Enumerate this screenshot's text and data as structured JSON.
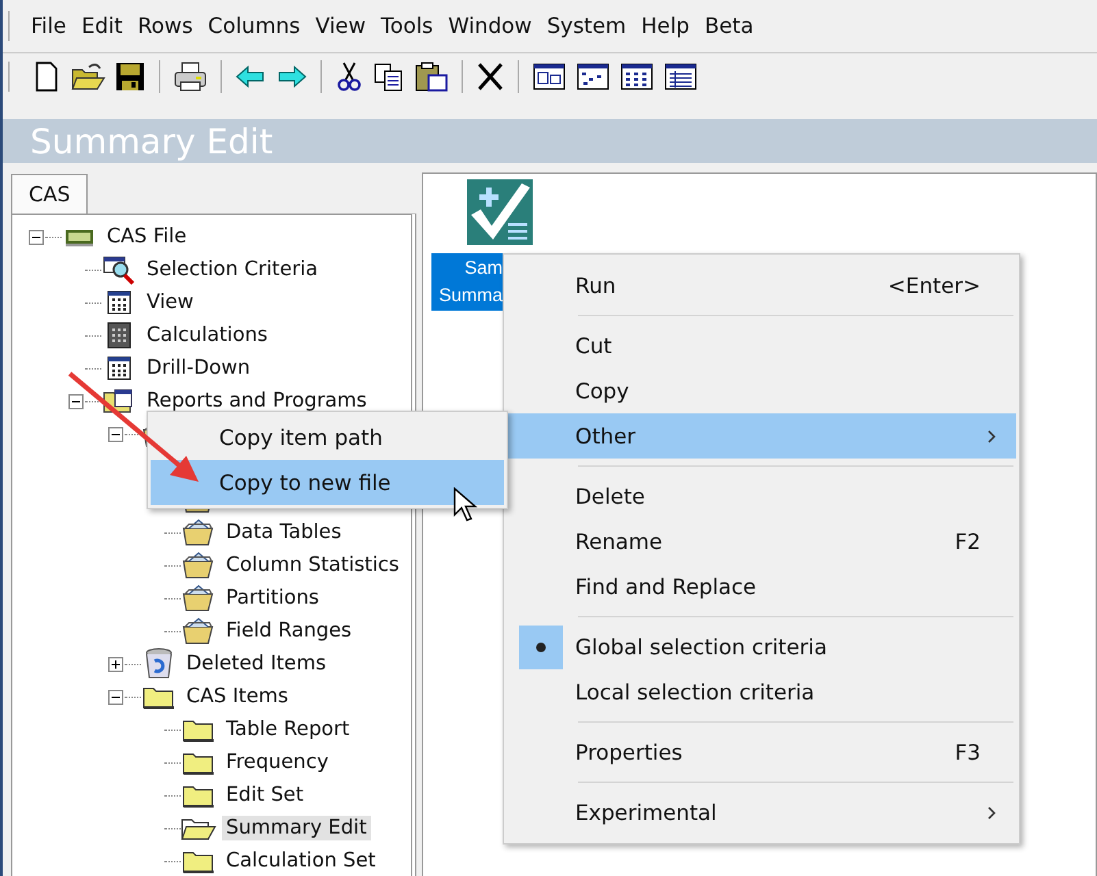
{
  "menu_bar": [
    "File",
    "Edit",
    "Rows",
    "Columns",
    "View",
    "Tools",
    "Window",
    "System",
    "Help",
    "Beta"
  ],
  "view_title": "Summary Edit",
  "tabs": [
    {
      "label": "CAS",
      "selected": true
    }
  ],
  "tree": [
    {
      "label": "CAS File",
      "kind": "file",
      "expanded": true,
      "selected": false,
      "children": [
        {
          "label": "Selection Criteria",
          "kind": "criteria",
          "selected": false
        },
        {
          "label": "View",
          "kind": "grid",
          "selected": false
        },
        {
          "label": "Calculations",
          "kind": "calc",
          "selected": false
        },
        {
          "label": "Drill-Down",
          "kind": "grid",
          "selected": false
        },
        {
          "label": "Reports and Programs",
          "kind": "reports",
          "expanded": true,
          "selected": false,
          "children": [
            {
              "kind": "report",
              "expanded": true,
              "children": [
                {
                  "kind": "hidden"
                },
                {
                  "kind": "report"
                },
                {
                  "label": "Data Tables",
                  "kind": "report",
                  "selected": false
                },
                {
                  "label": "Column Statistics",
                  "kind": "report",
                  "selected": false
                },
                {
                  "label": "Partitions",
                  "kind": "report",
                  "selected": false
                },
                {
                  "label": "Field Ranges",
                  "kind": "report",
                  "selected": false
                }
              ]
            },
            {
              "label": "Deleted Items",
              "kind": "trash",
              "expanded": false,
              "selected": false
            },
            {
              "label": "CAS Items",
              "kind": "folder",
              "expanded": true,
              "selected": false,
              "children": [
                {
                  "label": "Table Report",
                  "kind": "folder",
                  "selected": false
                },
                {
                  "label": "Frequency",
                  "kind": "folder",
                  "selected": false
                },
                {
                  "label": "Edit Set",
                  "kind": "folder",
                  "selected": false
                },
                {
                  "label": "Summary Edit",
                  "kind": "folder-open",
                  "selected": true
                },
                {
                  "label": "Calculation Set",
                  "kind": "folder",
                  "selected": false
                }
              ]
            }
          ]
        }
      ]
    }
  ],
  "items": [
    {
      "label_lines": [
        "Sam",
        "Summa"
      ],
      "selected": true
    }
  ],
  "context_menu": [
    {
      "kind": "item",
      "label": "Run",
      "shortcut": "<Enter>",
      "selected": false
    },
    {
      "kind": "separator"
    },
    {
      "kind": "item",
      "label": "Cut",
      "selected": false
    },
    {
      "kind": "item",
      "label": "Copy",
      "selected": false
    },
    {
      "kind": "submenu",
      "label": "Other",
      "selected": true
    },
    {
      "kind": "separator"
    },
    {
      "kind": "item",
      "label": "Delete",
      "selected": false
    },
    {
      "kind": "item",
      "label": "Rename",
      "shortcut": "F2",
      "selected": false
    },
    {
      "kind": "item",
      "label": "Find and Replace",
      "selected": false
    },
    {
      "kind": "separator"
    },
    {
      "kind": "item",
      "label": "Global selection criteria",
      "checked": true,
      "selected": false
    },
    {
      "kind": "item",
      "label": "Local selection criteria",
      "checked": false,
      "selected": false
    },
    {
      "kind": "separator"
    },
    {
      "kind": "item",
      "label": "Properties",
      "shortcut": "F3",
      "selected": false
    },
    {
      "kind": "separator"
    },
    {
      "kind": "submenu",
      "label": "Experimental",
      "selected": false
    }
  ],
  "submenu": [
    {
      "label": "Copy item path",
      "selected": false
    },
    {
      "label": "Copy to new file",
      "selected": true
    }
  ]
}
